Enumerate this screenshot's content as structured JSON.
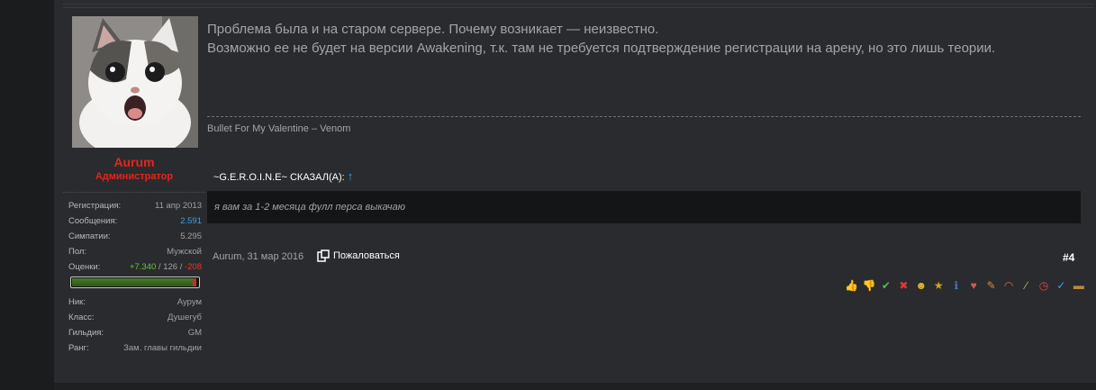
{
  "post": {
    "message_line1": "Проблема была и на старом сервере. Почему возникает — неизвестно.",
    "message_line2": "Возможно ее не будет на версии Awakening, т.к. там не требуется подтверждение регистрации на арену, но это лишь теории.",
    "signature": "Bullet For My Valentine – Venom",
    "quote_author": "~G.E.R.O.I.N.E~ СКАЗАЛ(А):",
    "quote_arrow": "↑",
    "quote_text": "я вам за 1-2 месяца фулл перса выкачаю",
    "meta": "Aurum, 31 мар 2016",
    "report_label": "Пожаловаться",
    "post_number": "#4"
  },
  "user": {
    "name": "Aurum",
    "title": "Администратор",
    "avatar_icon": "cat-avatar",
    "stats": {
      "registration_label": "Регистрация:",
      "registration_value": "11 апр 2013",
      "messages_label": "Сообщения:",
      "messages_value": "2.591",
      "likes_label": "Симпатии:",
      "likes_value": "5.295",
      "gender_label": "Пол:",
      "gender_value": "Мужской",
      "ratings_label": "Оценки:",
      "ratings_positive": "+7.340",
      "ratings_sep1": " / ",
      "ratings_neutral": "126",
      "ratings_sep2": " / ",
      "ratings_negative": "-208",
      "ratings_positive_fraction": 0.955
    },
    "custom": {
      "nick_label": "Ник:",
      "nick_value": "Аурум",
      "class_label": "Класс:",
      "class_value": "Душегуб",
      "guild_label": "Гильдия:",
      "guild_value": "GM",
      "rank_label": "Ранг:",
      "rank_value": "Зам. главы гильдии"
    }
  },
  "rating_icons": [
    "thumbs-up-icon",
    "thumbs-down-icon",
    "check-icon",
    "cross-icon",
    "smile-icon",
    "medal-icon",
    "info-icon",
    "heart-icon",
    "wrench-icon",
    "rainbow-icon",
    "brush-icon",
    "clock-icon",
    "twitter-icon",
    "wallet-icon"
  ],
  "colors": {
    "accent_blue": "#3ea0e4",
    "admin_red": "#e8241a",
    "positive_green": "#6ec03c",
    "negative_red": "#e23a2e"
  }
}
